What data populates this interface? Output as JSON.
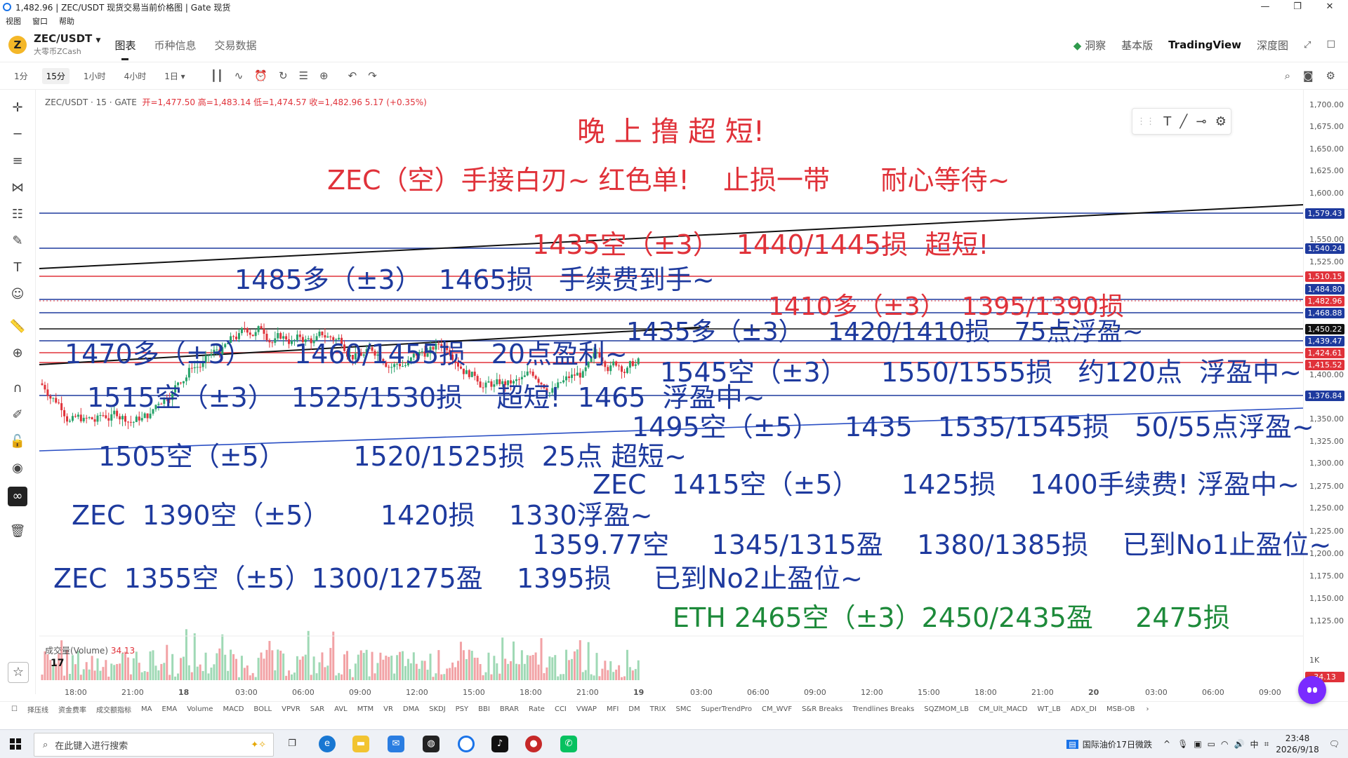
{
  "window": {
    "title": "1,482.96 | ZEC/USDT 现货交易当前价格图 | Gate 现货",
    "controls": [
      "—",
      "❐",
      "✕"
    ]
  },
  "menu": [
    "视图",
    "窗口",
    "帮助"
  ],
  "header": {
    "coin_letter": "Z",
    "pair": "ZEC/USDT",
    "pair_sub": "大零币ZCash",
    "tabs": [
      "图表",
      "币种信息",
      "交易数据"
    ],
    "right": [
      "洞察",
      "基本版",
      "TradingView",
      "深度图"
    ],
    "active_right": "TradingView"
  },
  "toolbar": {
    "timeframes": [
      "1分",
      "15分",
      "1小时",
      "4小时",
      "1日"
    ],
    "active_timeframe": "15分"
  },
  "info": {
    "label": "ZEC/USDT · 15 · GATE",
    "ohlc": "开=1,477.50 高=1,483.14 低=1,474.57 收=1,482.96 5.17 (+0.35%)"
  },
  "y_axis": {
    "ticks": [
      "1,700.00",
      "1,675.00",
      "1,650.00",
      "1,625.00",
      "1,600.00",
      "1,550.00",
      "1,525.00",
      "1,400.00",
      "1,375.00",
      "1,350.00",
      "1,325.00",
      "1,300.00",
      "1,275.00",
      "1,250.00",
      "1,225.00",
      "1,200.00",
      "1,175.00",
      "1,150.00",
      "1,125.00"
    ],
    "price_labels": [
      {
        "text": "1,579.43",
        "color": "#1e3a9e"
      },
      {
        "text": "1,540.24",
        "color": "#1e3a9e"
      },
      {
        "text": "1,510.15",
        "color": "#e0323a"
      },
      {
        "text": "1,484.80",
        "color": "#1e3a9e"
      },
      {
        "text": "1,482.96",
        "color": "#e0323a"
      },
      {
        "text": "1,468.88",
        "color": "#1e3a9e"
      },
      {
        "text": "1,450.22",
        "color": "#111111"
      },
      {
        "text": "1,439.47",
        "color": "#1e3a9e"
      },
      {
        "text": "1,424.61",
        "color": "#e0323a"
      },
      {
        "text": "1,415.52",
        "color": "#e0323a"
      },
      {
        "text": "1,376.84",
        "color": "#1e3a9e"
      }
    ],
    "vol_ticks": [
      "1K"
    ],
    "vol_label": "34.13"
  },
  "x_axis": {
    "ticks": [
      "18:00",
      "21:00",
      "18",
      "03:00",
      "06:00",
      "09:00",
      "12:00",
      "15:00",
      "18:00",
      "21:00",
      "19",
      "03:00",
      "06:00",
      "09:00",
      "12:00",
      "15:00",
      "18:00",
      "21:00",
      "20",
      "03:00",
      "06:00",
      "09:00"
    ]
  },
  "volume": {
    "label": "成交量(Volume)",
    "value": "34.13"
  },
  "indicators": [
    "择压线",
    "资金费率",
    "成交额指标",
    "MA",
    "EMA",
    "Volume",
    "MACD",
    "BOLL",
    "VPVR",
    "SAR",
    "AVL",
    "MTM",
    "VR",
    "DMA",
    "SKDJ",
    "PSY",
    "BBI",
    "BRAR",
    "Rate",
    "CCI",
    "VWAP",
    "MFI",
    "DM",
    "TRIX",
    "SMC",
    "SuperTrendPro",
    "CM_WVF",
    "S&R Breaks",
    "Trendlines Breaks",
    "SQZMOM_LB",
    "CM_Ult_MACD",
    "WT_LB",
    "ADX_DI",
    "MSB-OB"
  ],
  "annotations": [
    {
      "text": "晚 上 撸 超 短!",
      "color": "red"
    },
    {
      "text": "ZEC（空）手接白刃~ 红色单!    止损一带      耐心等待~",
      "color": "red"
    },
    {
      "text": "1435空（±3）  1440/1445损  超短!",
      "color": "red"
    },
    {
      "text": "1485多（±3）  1465损   手续费到手~",
      "color": "blue"
    },
    {
      "text": "1410多（±3）  1395/1390损",
      "color": "red"
    },
    {
      "text": "1435多（±3）   1420/1410损   75点浮盈~",
      "color": "blue"
    },
    {
      "text": "1470多（±3）     1460/1455损   20点盈利~",
      "color": "blue"
    },
    {
      "text": "1545空（±3）    1550/1555损   约120点  浮盈中~",
      "color": "blue"
    },
    {
      "text": "1515空（±3）  1525/1530损    超短!  1465  浮盈中~",
      "color": "blue"
    },
    {
      "text": "1495空（±5）   1435   1535/1545损   50/55点浮盈~",
      "color": "blue"
    },
    {
      "text": "1505空（±5）        1520/1525损  25点 超短~",
      "color": "blue"
    },
    {
      "text": "ZEC   1415空（±5）     1425损    1400手续费! 浮盈中~",
      "color": "blue"
    },
    {
      "text": "ZEC  1390空（±5）      1420损    1330浮盈~",
      "color": "blue"
    },
    {
      "text": "1359.77空     1345/1315盈    1380/1385损    已到No1止盈位~",
      "color": "blue"
    },
    {
      "text": "ZEC  1355空（±5）1300/1275盈    1395损     已到No2止盈位~",
      "color": "blue"
    },
    {
      "text": "ETH 2465空（±3）2450/2435盈     2475损",
      "color": "green"
    }
  ],
  "taskbar": {
    "search_placeholder": "在此键入进行搜索",
    "news": "国际油价17日微跌",
    "ime": "中",
    "time": "23:48",
    "date": "2026/9/18"
  },
  "icons": {
    "left_tools": [
      "crosshair-icon",
      "horizontal-line-icon",
      "channel-icon",
      "pattern-icon",
      "fib-icon",
      "brush-icon",
      "text-icon",
      "emoji-icon",
      "ruler-icon",
      "zoom-icon",
      "magnet-icon",
      "pencil-lock-icon",
      "lock-icon",
      "eye-icon",
      "link-icon",
      "trash-icon"
    ]
  }
}
